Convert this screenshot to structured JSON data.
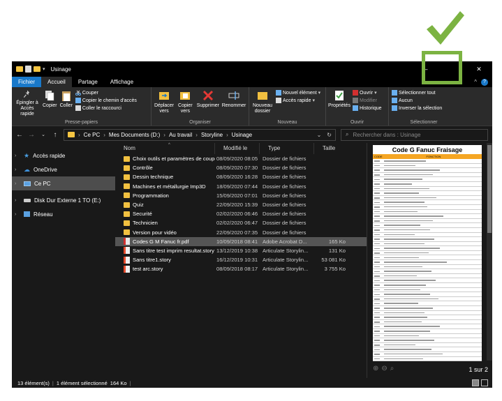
{
  "window": {
    "title": "Usinage",
    "controls": {
      "minimize": "–",
      "maximize": "☐",
      "close": "✕"
    }
  },
  "ribbon": {
    "tabs": [
      "Fichier",
      "Accueil",
      "Partage",
      "Affichage"
    ],
    "active_tab": "Accueil",
    "groups": [
      {
        "label": "Presse-papiers",
        "buttons": [
          "Épingler à Accès rapide",
          "Copier",
          "Coller"
        ],
        "list": [
          "Couper",
          "Copier le chemin d'accès",
          "Coller le raccourci"
        ]
      },
      {
        "label": "Organiser",
        "buttons": [
          "Déplacer vers",
          "Copier vers",
          "Supprimer",
          "Renommer"
        ]
      },
      {
        "label": "Nouveau",
        "buttons": [
          "Nouveau dossier"
        ],
        "list": [
          "Nouvel élément",
          "Accès rapide"
        ]
      },
      {
        "label": "Ouvrir",
        "buttons": [
          "Propriétés"
        ],
        "list": [
          "Ouvrir",
          "Modifier",
          "Historique"
        ]
      },
      {
        "label": "Sélectionner",
        "list": [
          "Sélectionner tout",
          "Aucun",
          "Inverser la sélection"
        ]
      }
    ]
  },
  "address": {
    "path": [
      "Ce PC",
      "Mes Documents (D:)",
      "Au travail",
      "Storyline",
      "Usinage"
    ],
    "search_placeholder": "Rechercher dans : Usinage"
  },
  "nav": [
    {
      "label": "Accès rapide",
      "icon": "star-icon",
      "color": "#4a9ee0"
    },
    {
      "label": "OneDrive",
      "icon": "cloud-icon",
      "color": "#3d8fd8"
    },
    {
      "label": "Ce PC",
      "icon": "computer-icon",
      "color": "#5aa0e0",
      "selected": true
    },
    {
      "label": "Disk Dur Externe 1 TO (E:)",
      "icon": "drive-icon",
      "color": "#cccccc"
    },
    {
      "label": "Réseau",
      "icon": "network-icon",
      "color": "#5aa0e0"
    }
  ],
  "columns": [
    "Nom",
    "Modifié le",
    "Type",
    "Taille"
  ],
  "files": [
    {
      "name": "Choix outils et paramètres de coupe",
      "modified": "08/09/2020 08:05",
      "type": "Dossier de fichiers",
      "size": "",
      "icon": "folder"
    },
    {
      "name": "Contrôle",
      "modified": "08/09/2020 07:30",
      "type": "Dossier de fichiers",
      "size": "",
      "icon": "folder"
    },
    {
      "name": "Dessin technique",
      "modified": "08/09/2020 16:28",
      "type": "Dossier de fichiers",
      "size": "",
      "icon": "folder"
    },
    {
      "name": "Machines et métallurgie Imp3D",
      "modified": "18/09/2020 07:44",
      "type": "Dossier de fichiers",
      "size": "",
      "icon": "folder"
    },
    {
      "name": "Programmation",
      "modified": "15/09/2020 07:01",
      "type": "Dossier de fichiers",
      "size": "",
      "icon": "folder"
    },
    {
      "name": "Quiz",
      "modified": "22/09/2020 15:39",
      "type": "Dossier de fichiers",
      "size": "",
      "icon": "folder"
    },
    {
      "name": "Securité",
      "modified": "02/02/2020 06:46",
      "type": "Dossier de fichiers",
      "size": "",
      "icon": "folder"
    },
    {
      "name": "Technicien",
      "modified": "02/02/2020 06:47",
      "type": "Dossier de fichiers",
      "size": "",
      "icon": "folder"
    },
    {
      "name": "Version pour vidéo",
      "modified": "22/09/2020 07:35",
      "type": "Dossier de fichiers",
      "size": "",
      "icon": "folder"
    },
    {
      "name": "Codes G M Fanuc fr.pdf",
      "modified": "10/09/2018 08:41",
      "type": "Adobe Acrobat D...",
      "size": "165 Ko",
      "icon": "pdf",
      "selected": true
    },
    {
      "name": "Sans titre test imprim resultat.story",
      "modified": "13/12/2019 10:38",
      "type": "Articulate Storylin...",
      "size": "131 Ko",
      "icon": "story"
    },
    {
      "name": "Sans titre1.story",
      "modified": "16/12/2019 10:31",
      "type": "Articulate Storylin...",
      "size": "53 081 Ko",
      "icon": "story"
    },
    {
      "name": "test arc.story",
      "modified": "08/09/2018 08:17",
      "type": "Articulate Storylin...",
      "size": "3 755 Ko",
      "icon": "story"
    }
  ],
  "preview": {
    "doc_title": "Code G Fanuc Fraisage",
    "col_code": "CODE",
    "col_function": "FONCTION",
    "page_count": "1 sur 2"
  },
  "status": {
    "count": "13 élément(s)",
    "selection": "1 élément sélectionné",
    "size": "164 Ko"
  },
  "colors": {
    "accent": "#1979ca",
    "highlight": "#7cb342",
    "folder": "#f1c040",
    "doc_header": "#f5a623"
  }
}
